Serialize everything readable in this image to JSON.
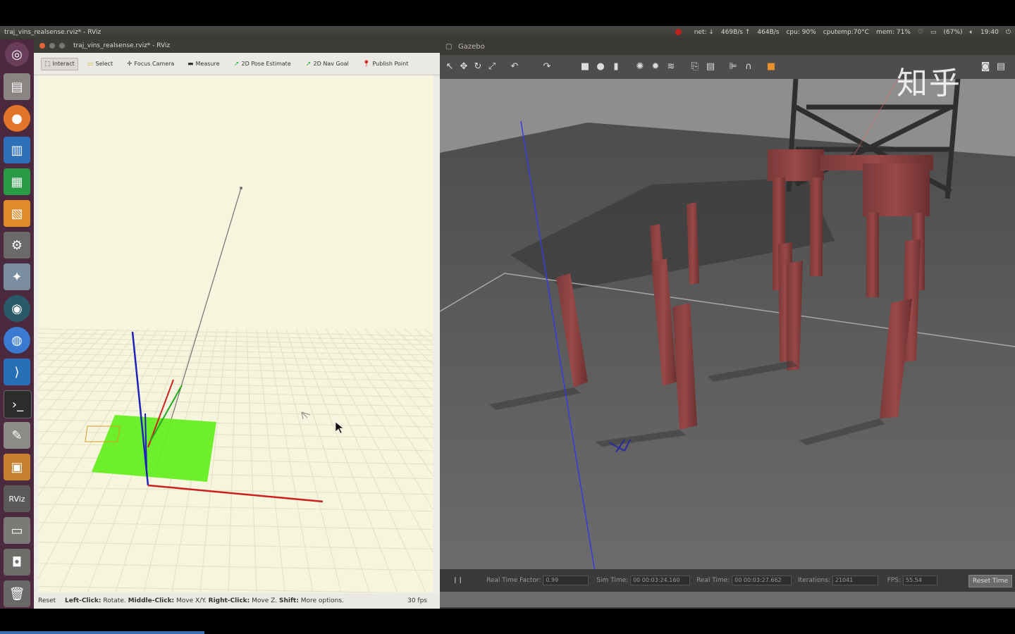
{
  "system_bar": {
    "window_title": "traj_vins_realsense.rviz* - RViz",
    "tray": [
      "net: ↓",
      "469B/s ↑",
      "464B/s",
      "cpu: 90%",
      "cputemp:70°C",
      "mem: 71%",
      "(67%)",
      "19:40"
    ]
  },
  "launcher": {
    "items": [
      "ubuntu",
      "files",
      "firefox",
      "writer",
      "calc",
      "impress",
      "settings",
      "tweak",
      "browser",
      "thunderbird",
      "vscode",
      "terminal",
      "editor",
      "box",
      "rviz",
      "drive",
      "screenshot",
      "trash"
    ]
  },
  "rviz": {
    "title": "traj_vins_realsense.rviz* - RViz",
    "tools": [
      {
        "label": "Interact",
        "icon": "cursor"
      },
      {
        "label": "Select",
        "icon": "select"
      },
      {
        "label": "Focus Camera",
        "icon": "crosshair"
      },
      {
        "label": "Measure",
        "icon": "ruler"
      },
      {
        "label": "2D Pose Estimate",
        "icon": "arrow-green"
      },
      {
        "label": "2D Nav Goal",
        "icon": "arrow-green"
      },
      {
        "label": "Publish Point",
        "icon": "pin"
      }
    ],
    "status": {
      "reset": "Reset",
      "left_click": "Left-Click:",
      "left_action": "Rotate.",
      "middle_click": "Middle-Click:",
      "middle_action": "Move X/Y.",
      "right_click": "Right-Click:",
      "right_action": "Move Z.",
      "shift": "Shift:",
      "shift_action": "More options.",
      "fps": "30 fps"
    }
  },
  "gazebo": {
    "title": "Gazebo",
    "status": {
      "rtf_label": "Real Time Factor:",
      "rtf_value": "0.99",
      "sim_label": "Sim Time:",
      "sim_value": "00 00:03:24.160",
      "real_label": "Real Time:",
      "real_value": "00 00:03:27.662",
      "iter_label": "Iterations:",
      "iter_value": "21041",
      "fps_label": "FPS:",
      "fps_value": "55.54",
      "reset_label": "Reset Time"
    }
  },
  "watermark": "知乎",
  "colors": {
    "launcher": "#4b2a3f",
    "rviz_bg": "#f6f5dd",
    "pose_plane": "#66ee22",
    "axis_x": "#cc2020",
    "axis_y": "#22aa22",
    "axis_z": "#2020bb"
  }
}
